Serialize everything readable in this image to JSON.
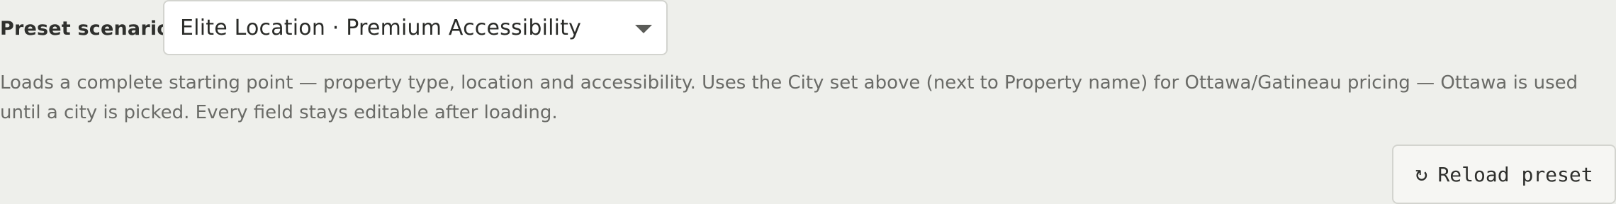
{
  "preset": {
    "label": "Preset scenario",
    "selected_value": "Elite Location · Premium Accessibility",
    "help_text": "Loads a complete starting point — property type, location and accessibility. Uses the City set above (next to Property name) for Ottawa/Gatineau pricing — Ottawa is used until a city is picked. Every field stays editable after loading.",
    "reload_icon": "↻",
    "reload_label": "Reload preset"
  }
}
